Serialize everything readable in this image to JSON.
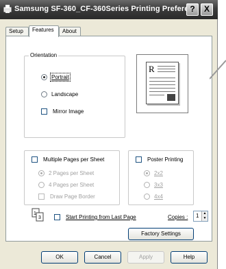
{
  "window": {
    "title": "Samsung SF-360_CF-360Series Printing Prefere...",
    "help_button": "?",
    "close_button": "X"
  },
  "tabs": [
    {
      "label": "Setup"
    },
    {
      "label": "Features"
    },
    {
      "label": "About"
    }
  ],
  "orientation": {
    "label": "Orientation",
    "options": [
      "Portrait",
      "Landscape"
    ],
    "selected": "Portrait",
    "mirror_label": "Mirror Image",
    "mirror_checked": false
  },
  "multiple_pages": {
    "label": "Multiple Pages per Sheet",
    "checked": false,
    "options": [
      "2 Pages per Sheet",
      "4 Pages per Sheet"
    ],
    "selected": "2 Pages per Sheet",
    "border_label": "Draw Page Border"
  },
  "poster": {
    "label": "Poster Printing",
    "checked": false,
    "options": [
      "2x2",
      "3x3",
      "4x4"
    ],
    "selected": "2x2"
  },
  "start_last_page": {
    "label": "Start Printing from Last Page",
    "checked": false
  },
  "copies": {
    "label": "Copies :",
    "value": "1"
  },
  "buttons": {
    "factory_settings": "Factory Settings",
    "ok": "OK",
    "cancel": "Cancel",
    "apply": "Apply",
    "help": "Help"
  }
}
